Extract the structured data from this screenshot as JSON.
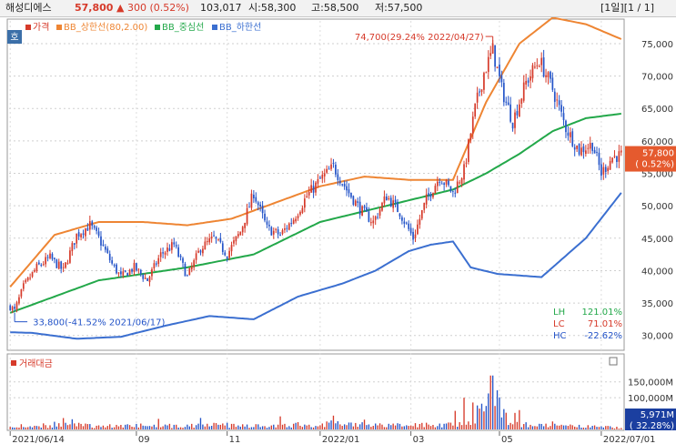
{
  "header": {
    "name": "해성디에스",
    "price": "57,800",
    "change": "▲ 300 (0.52%)",
    "volume": "103,017",
    "open": "시:58,300",
    "high": "고:58,500",
    "low": "저:57,500",
    "pager": "[1일][1 / 1]"
  },
  "colors": {
    "price": "#d63a2a",
    "down": "#2454c8",
    "bb_upper": "#ee8533",
    "bb_mid": "#23a84a",
    "bb_lower": "#3b6fd0",
    "price_tag": "#e55a2e",
    "vol_tag": "#1b3fa0"
  },
  "chart_data": [
    {
      "type": "line",
      "legend": [
        "가격",
        "BB_상한선(80,2.00)",
        "BB_중심선",
        "BB_하한선"
      ],
      "side_label": "호",
      "yticks": [
        "75,000",
        "70,000",
        "65,000",
        "60,000",
        "55,000",
        "50,000",
        "45,000",
        "40,000",
        "35,000",
        "30,000"
      ],
      "ylim": [
        28000,
        78500
      ],
      "xticks": [
        {
          "i": 0,
          "label": "2021/06/14"
        },
        {
          "i": 57,
          "label": "09"
        },
        {
          "i": 98,
          "label": "11"
        },
        {
          "i": 140,
          "label": "2022/01"
        },
        {
          "i": 181,
          "label": "03"
        },
        {
          "i": 221,
          "label": "05"
        },
        {
          "i": 267,
          "label": "2022/07/01"
        }
      ],
      "n_days": 276,
      "price_keys": [
        [
          0,
          34500
        ],
        [
          2,
          33800
        ],
        [
          6,
          37500
        ],
        [
          12,
          40500
        ],
        [
          18,
          42000
        ],
        [
          24,
          40000
        ],
        [
          30,
          45500
        ],
        [
          36,
          47000
        ],
        [
          40,
          45000
        ],
        [
          46,
          41000
        ],
        [
          50,
          39000
        ],
        [
          56,
          40500
        ],
        [
          62,
          38500
        ],
        [
          68,
          42500
        ],
        [
          74,
          44000
        ],
        [
          80,
          39000
        ],
        [
          86,
          43500
        ],
        [
          92,
          45000
        ],
        [
          98,
          42500
        ],
        [
          104,
          46000
        ],
        [
          110,
          52000
        ],
        [
          116,
          46500
        ],
        [
          122,
          45500
        ],
        [
          128,
          48000
        ],
        [
          134,
          51500
        ],
        [
          140,
          54000
        ],
        [
          146,
          56000
        ],
        [
          152,
          52500
        ],
        [
          158,
          49500
        ],
        [
          164,
          47500
        ],
        [
          170,
          51500
        ],
        [
          176,
          49000
        ],
        [
          182,
          45000
        ],
        [
          188,
          51000
        ],
        [
          194,
          54500
        ],
        [
          200,
          52000
        ],
        [
          205,
          55500
        ],
        [
          210,
          65000
        ],
        [
          214,
          70500
        ],
        [
          218,
          74000
        ],
        [
          222,
          68000
        ],
        [
          227,
          63000
        ],
        [
          233,
          69000
        ],
        [
          239,
          72500
        ],
        [
          245,
          68000
        ],
        [
          251,
          62000
        ],
        [
          257,
          58500
        ],
        [
          263,
          59500
        ],
        [
          267,
          55000
        ],
        [
          272,
          57500
        ],
        [
          276,
          57800
        ]
      ],
      "bb_upper_keys": [
        [
          0,
          37500
        ],
        [
          20,
          45500
        ],
        [
          40,
          47500
        ],
        [
          60,
          47500
        ],
        [
          80,
          47000
        ],
        [
          100,
          48000
        ],
        [
          120,
          50500
        ],
        [
          140,
          53000
        ],
        [
          160,
          54500
        ],
        [
          180,
          54000
        ],
        [
          200,
          54000
        ],
        [
          215,
          66000
        ],
        [
          230,
          75000
        ],
        [
          245,
          79000
        ],
        [
          260,
          78000
        ],
        [
          276,
          75700
        ]
      ],
      "bb_mid_keys": [
        [
          0,
          33500
        ],
        [
          40,
          38500
        ],
        [
          80,
          40500
        ],
        [
          110,
          42500
        ],
        [
          140,
          47500
        ],
        [
          170,
          50000
        ],
        [
          200,
          52500
        ],
        [
          215,
          55000
        ],
        [
          230,
          58000
        ],
        [
          245,
          61500
        ],
        [
          260,
          63500
        ],
        [
          276,
          64200
        ]
      ],
      "bb_lower_keys": [
        [
          0,
          30500
        ],
        [
          10,
          30400
        ],
        [
          30,
          29500
        ],
        [
          50,
          29800
        ],
        [
          70,
          31500
        ],
        [
          90,
          33000
        ],
        [
          110,
          32500
        ],
        [
          130,
          36000
        ],
        [
          150,
          38000
        ],
        [
          165,
          40000
        ],
        [
          180,
          43000
        ],
        [
          190,
          44000
        ],
        [
          200,
          44500
        ],
        [
          208,
          40500
        ],
        [
          220,
          39500
        ],
        [
          240,
          39000
        ],
        [
          260,
          45000
        ],
        [
          276,
          52000
        ]
      ],
      "max_marker": {
        "i": 218,
        "label": "74,700(29.24% 2022/04/27)"
      },
      "min_marker": {
        "i": 2,
        "label": "33,800(-41.52% 2021/06/17)"
      },
      "stats": [
        {
          "key": "LH",
          "value": "121.01%"
        },
        {
          "key": "LC",
          "value": "71.01%"
        },
        {
          "key": "HC",
          "value": "-22.62%"
        }
      ],
      "last_price_tag": [
        "57,800",
        "( 0.52%)"
      ]
    },
    {
      "type": "bar",
      "legend": [
        "거래대금"
      ],
      "yticks": [
        "150,000M",
        "100,000M"
      ],
      "ylim": [
        0,
        175000
      ],
      "vol_keys": [
        [
          0,
          5000
        ],
        [
          20,
          15000
        ],
        [
          40,
          11000
        ],
        [
          60,
          12000
        ],
        [
          80,
          11000
        ],
        [
          100,
          14000
        ],
        [
          120,
          11000
        ],
        [
          140,
          18000
        ],
        [
          160,
          14000
        ],
        [
          180,
          12000
        ],
        [
          200,
          18000
        ],
        [
          206,
          30000
        ],
        [
          210,
          45000
        ],
        [
          214,
          65000
        ],
        [
          218,
          155000
        ],
        [
          222,
          45000
        ],
        [
          228,
          20000
        ],
        [
          240,
          12000
        ],
        [
          260,
          9000
        ],
        [
          276,
          6000
        ]
      ],
      "last_value_tag": [
        "5,971M",
        "( 32.28%)"
      ]
    }
  ]
}
